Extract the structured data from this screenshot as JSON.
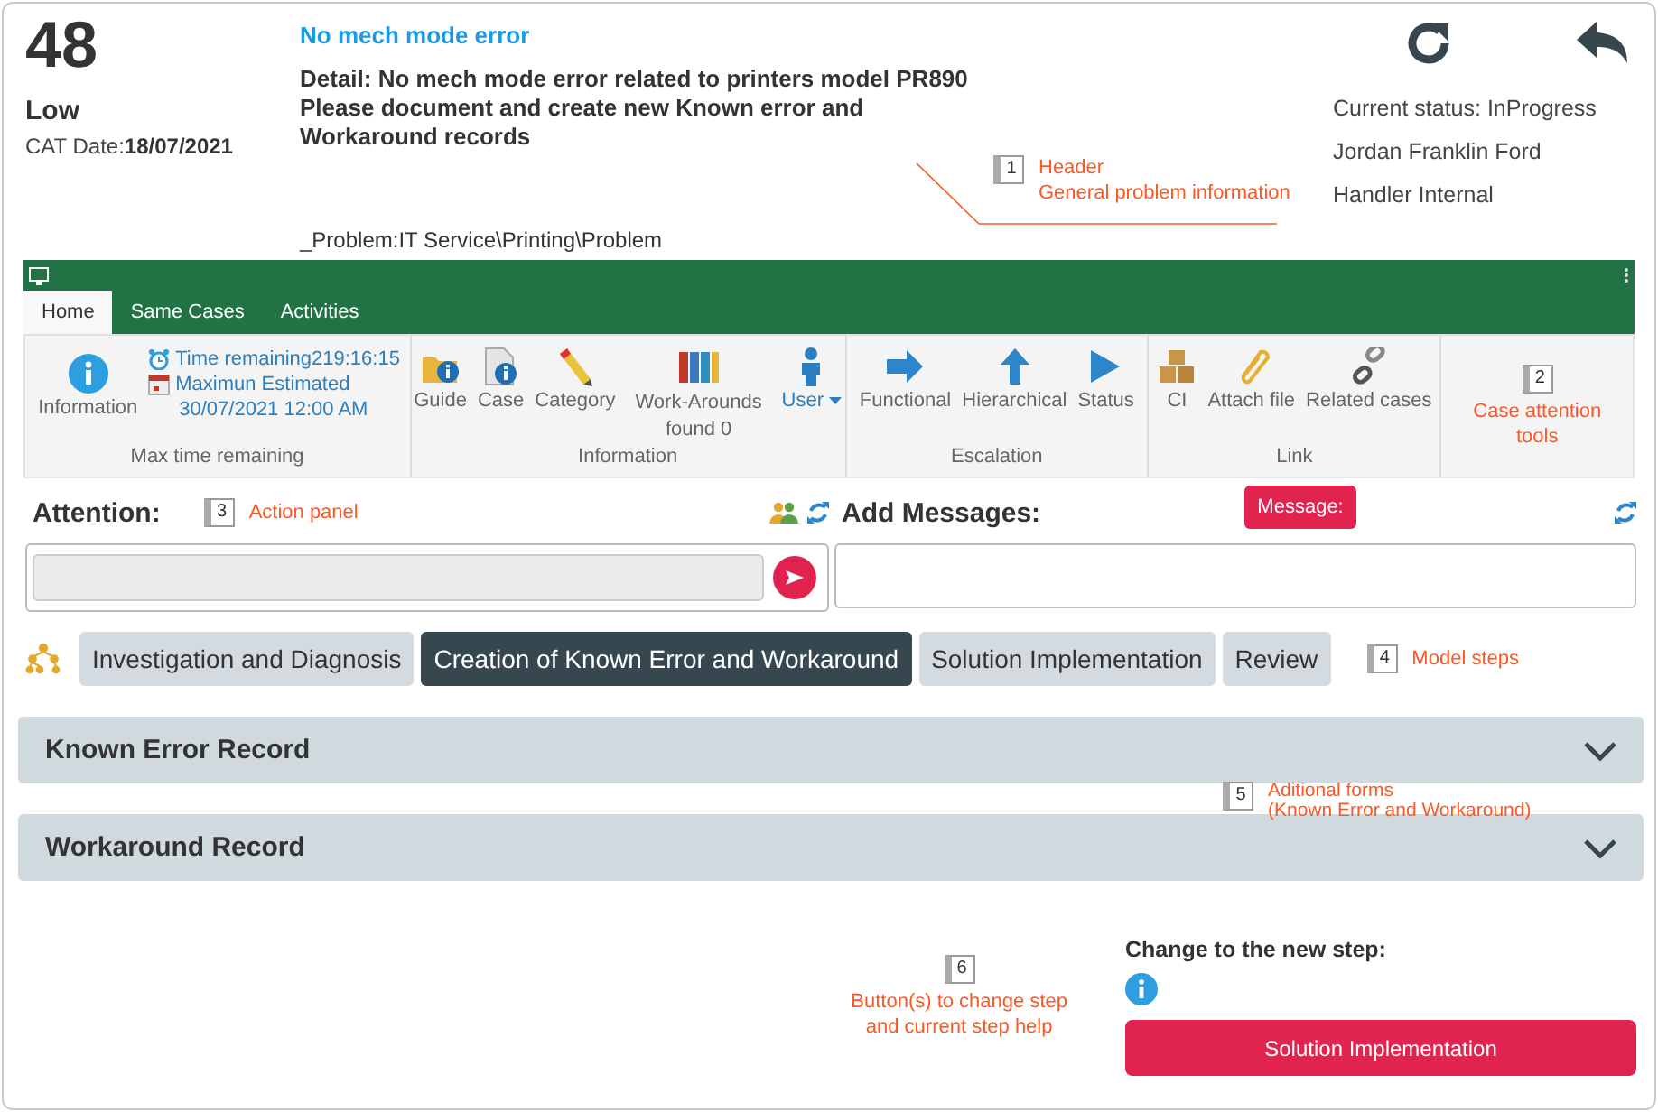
{
  "header": {
    "number": "48",
    "priority": "Low",
    "cat_date_label": "CAT Date:",
    "cat_date": "18/07/2021",
    "title": "No mech mode error",
    "detail": "Detail: No mech mode error related to printers model PR890\nPlease document and create new Known error and\nWorkaround records",
    "path": "_Problem:IT Service\\Printing\\Problem",
    "status_lines": [
      "Current status: InProgress",
      "Jordan Franklin Ford",
      "Handler Internal"
    ]
  },
  "ribbon": {
    "tabs": [
      {
        "label": "Home",
        "selected": true
      },
      {
        "label": "Same Cases",
        "selected": false
      },
      {
        "label": "Activities",
        "selected": false
      }
    ],
    "groups": [
      {
        "label": "Max time remaining",
        "items": [
          {
            "kind": "button",
            "label": "Information"
          }
        ],
        "details": [
          {
            "kind": "timer",
            "text": "Time remaining219:16:15"
          },
          {
            "kind": "calendar",
            "text": "Maximun Estimated"
          },
          {
            "kind": "plain",
            "text": "30/07/2021 12:00 AM"
          }
        ]
      },
      {
        "label": "Information",
        "items": [
          {
            "kind": "button",
            "label": "Guide"
          },
          {
            "kind": "button",
            "label": "Case"
          },
          {
            "kind": "button",
            "label": "Category"
          },
          {
            "kind": "button",
            "label": "Work-Arounds found 0"
          },
          {
            "kind": "menu",
            "label": "User"
          }
        ]
      },
      {
        "label": "Escalation",
        "items": [
          {
            "kind": "button",
            "label": "Functional"
          },
          {
            "kind": "button",
            "label": "Hierarchical"
          },
          {
            "kind": "button",
            "label": "Status"
          }
        ]
      },
      {
        "label": "Link",
        "items": [
          {
            "kind": "button",
            "label": "CI"
          },
          {
            "kind": "button",
            "label": "Attach file"
          },
          {
            "kind": "button",
            "label": "Related cases"
          }
        ]
      }
    ]
  },
  "attention": {
    "label": "Attention:"
  },
  "messages": {
    "label": "Add Messages:",
    "button": "Message:"
  },
  "steps": [
    {
      "label": "Investigation and Diagnosis",
      "selected": false
    },
    {
      "label": "Creation of Known Error and Workaround",
      "selected": true
    },
    {
      "label": "Solution Implementation",
      "selected": false
    },
    {
      "label": "Review",
      "selected": false
    }
  ],
  "forms": [
    {
      "title": "Known Error Record",
      "expanded": false
    },
    {
      "title": "Workaround Record",
      "expanded": false
    }
  ],
  "change_step": {
    "label": "Change to the new step:",
    "button": "Solution Implementation"
  },
  "callouts": [
    {
      "number": "1",
      "text": "Header\nGeneral problem information"
    },
    {
      "number": "2",
      "text": "Case attention\ntools"
    },
    {
      "number": "3",
      "text": "Action panel"
    },
    {
      "number": "4",
      "text": "Model steps"
    },
    {
      "number": "5",
      "text": "Aditional forms\n(Known Error and Workaround)"
    },
    {
      "number": "6",
      "text": "Button(s) to change step\nand current step help"
    }
  ]
}
